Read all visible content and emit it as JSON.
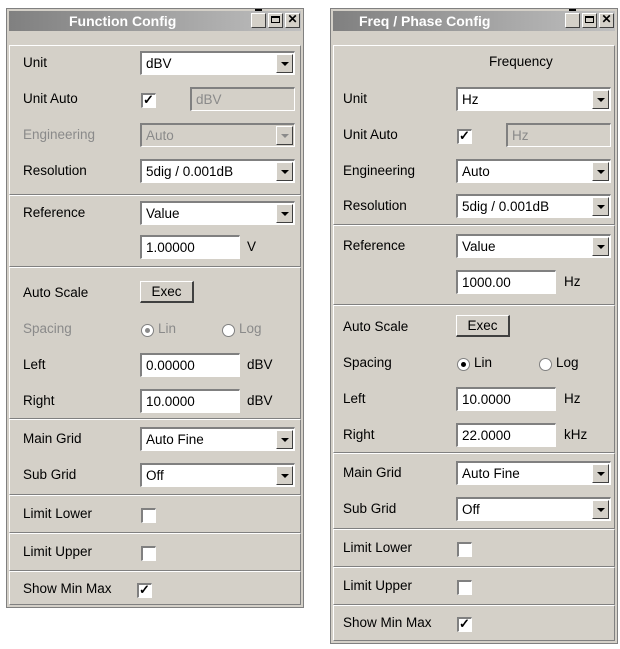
{
  "left": {
    "title": "Function Config",
    "win": {
      "min": "_",
      "max": "□",
      "close": "✕"
    },
    "unit": {
      "label": "Unit",
      "value": "dBV"
    },
    "unit_auto": {
      "label": "Unit Auto",
      "checked": "✓",
      "field": "dBV"
    },
    "engineering": {
      "label": "Engineering",
      "value": "Auto"
    },
    "resolution": {
      "label": "Resolution",
      "value": "5dig / 0.001dB"
    },
    "reference": {
      "label": "Reference",
      "value": "Value",
      "input": "1.00000",
      "unit": "V"
    },
    "auto_scale": {
      "label": "Auto Scale",
      "button": "Exec"
    },
    "spacing": {
      "label": "Spacing",
      "lin": "Lin",
      "log": "Log",
      "selected": "Lin"
    },
    "left_row": {
      "label": "Left",
      "value": "0.00000",
      "unit": "dBV"
    },
    "right_row": {
      "label": "Right",
      "value": "10.0000",
      "unit": "dBV"
    },
    "main_grid": {
      "label": "Main Grid",
      "value": "Auto Fine"
    },
    "sub_grid": {
      "label": "Sub Grid",
      "value": "Off"
    },
    "limit_lower": {
      "label": "Limit Lower"
    },
    "limit_upper": {
      "label": "Limit Upper"
    },
    "show_min_max": {
      "label": "Show Min Max",
      "checked": "✓"
    }
  },
  "right": {
    "title": "Freq / Phase Config",
    "win": {
      "min": "_",
      "max": "□",
      "close": "✕"
    },
    "header": "Frequency",
    "unit": {
      "label": "Unit",
      "value": "Hz"
    },
    "unit_auto": {
      "label": "Unit Auto",
      "checked": "✓",
      "field": "Hz"
    },
    "engineering": {
      "label": "Engineering",
      "value": "Auto"
    },
    "resolution": {
      "label": "Resolution",
      "value": "5dig / 0.001dB"
    },
    "reference": {
      "label": "Reference",
      "value": "Value",
      "input": "1000.00",
      "unit": "Hz"
    },
    "auto_scale": {
      "label": "Auto Scale",
      "button": "Exec"
    },
    "spacing": {
      "label": "Spacing",
      "lin": "Lin",
      "log": "Log",
      "selected": "Lin"
    },
    "left_row": {
      "label": "Left",
      "value": "10.0000",
      "unit": "Hz"
    },
    "right_row": {
      "label": "Right",
      "value": "22.0000",
      "unit": "kHz"
    },
    "main_grid": {
      "label": "Main Grid",
      "value": "Auto Fine"
    },
    "sub_grid": {
      "label": "Sub Grid",
      "value": "Off"
    },
    "limit_lower": {
      "label": "Limit Lower"
    },
    "limit_upper": {
      "label": "Limit Upper"
    },
    "show_min_max": {
      "label": "Show Min Max",
      "checked": "✓"
    }
  }
}
